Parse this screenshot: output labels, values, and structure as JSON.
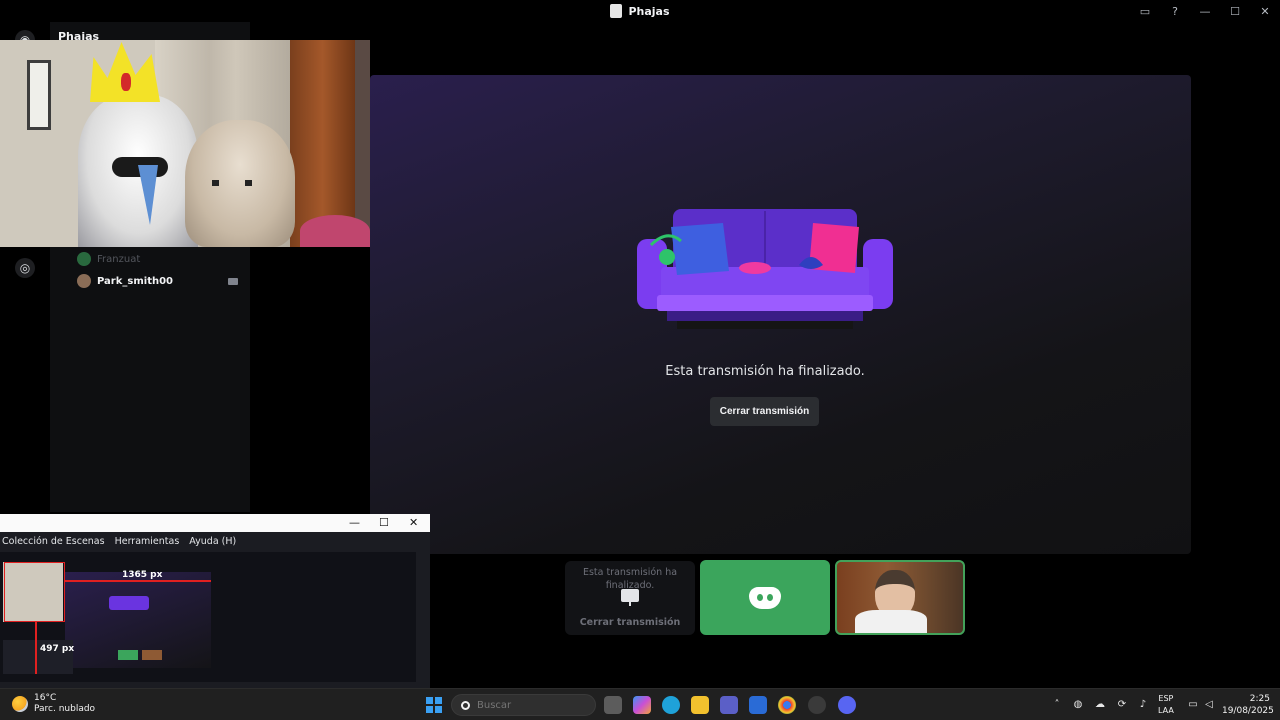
{
  "window": {
    "title": "Phajas"
  },
  "discord": {
    "server_name": "Phajas",
    "members": [
      {
        "name": "Franzuat",
        "muted": true
      },
      {
        "name": "Park_smith00",
        "muted": false
      }
    ],
    "stream": {
      "ended_message": "Esta transmisión ha finalizado.",
      "close_button": "Cerrar transmisión"
    },
    "tiles": {
      "ended_text": "Esta transmisión ha finalizado.",
      "ended_button": "Cerrar transmisión"
    },
    "colors": {
      "green": "#3ba55c",
      "background": "#000000"
    }
  },
  "obs": {
    "menu": [
      "Colección de Escenas",
      "Herramientas",
      "Ayuda (H)"
    ],
    "preview": {
      "width_label": "1365 px",
      "height_label": "497 px"
    }
  },
  "taskbar": {
    "weather": {
      "temp": "16°C",
      "desc": "Parc. nublado"
    },
    "search_placeholder": "Buscar",
    "language": [
      "ESP",
      "LAA"
    ],
    "time": "2:25",
    "date": "19/08/2025"
  }
}
